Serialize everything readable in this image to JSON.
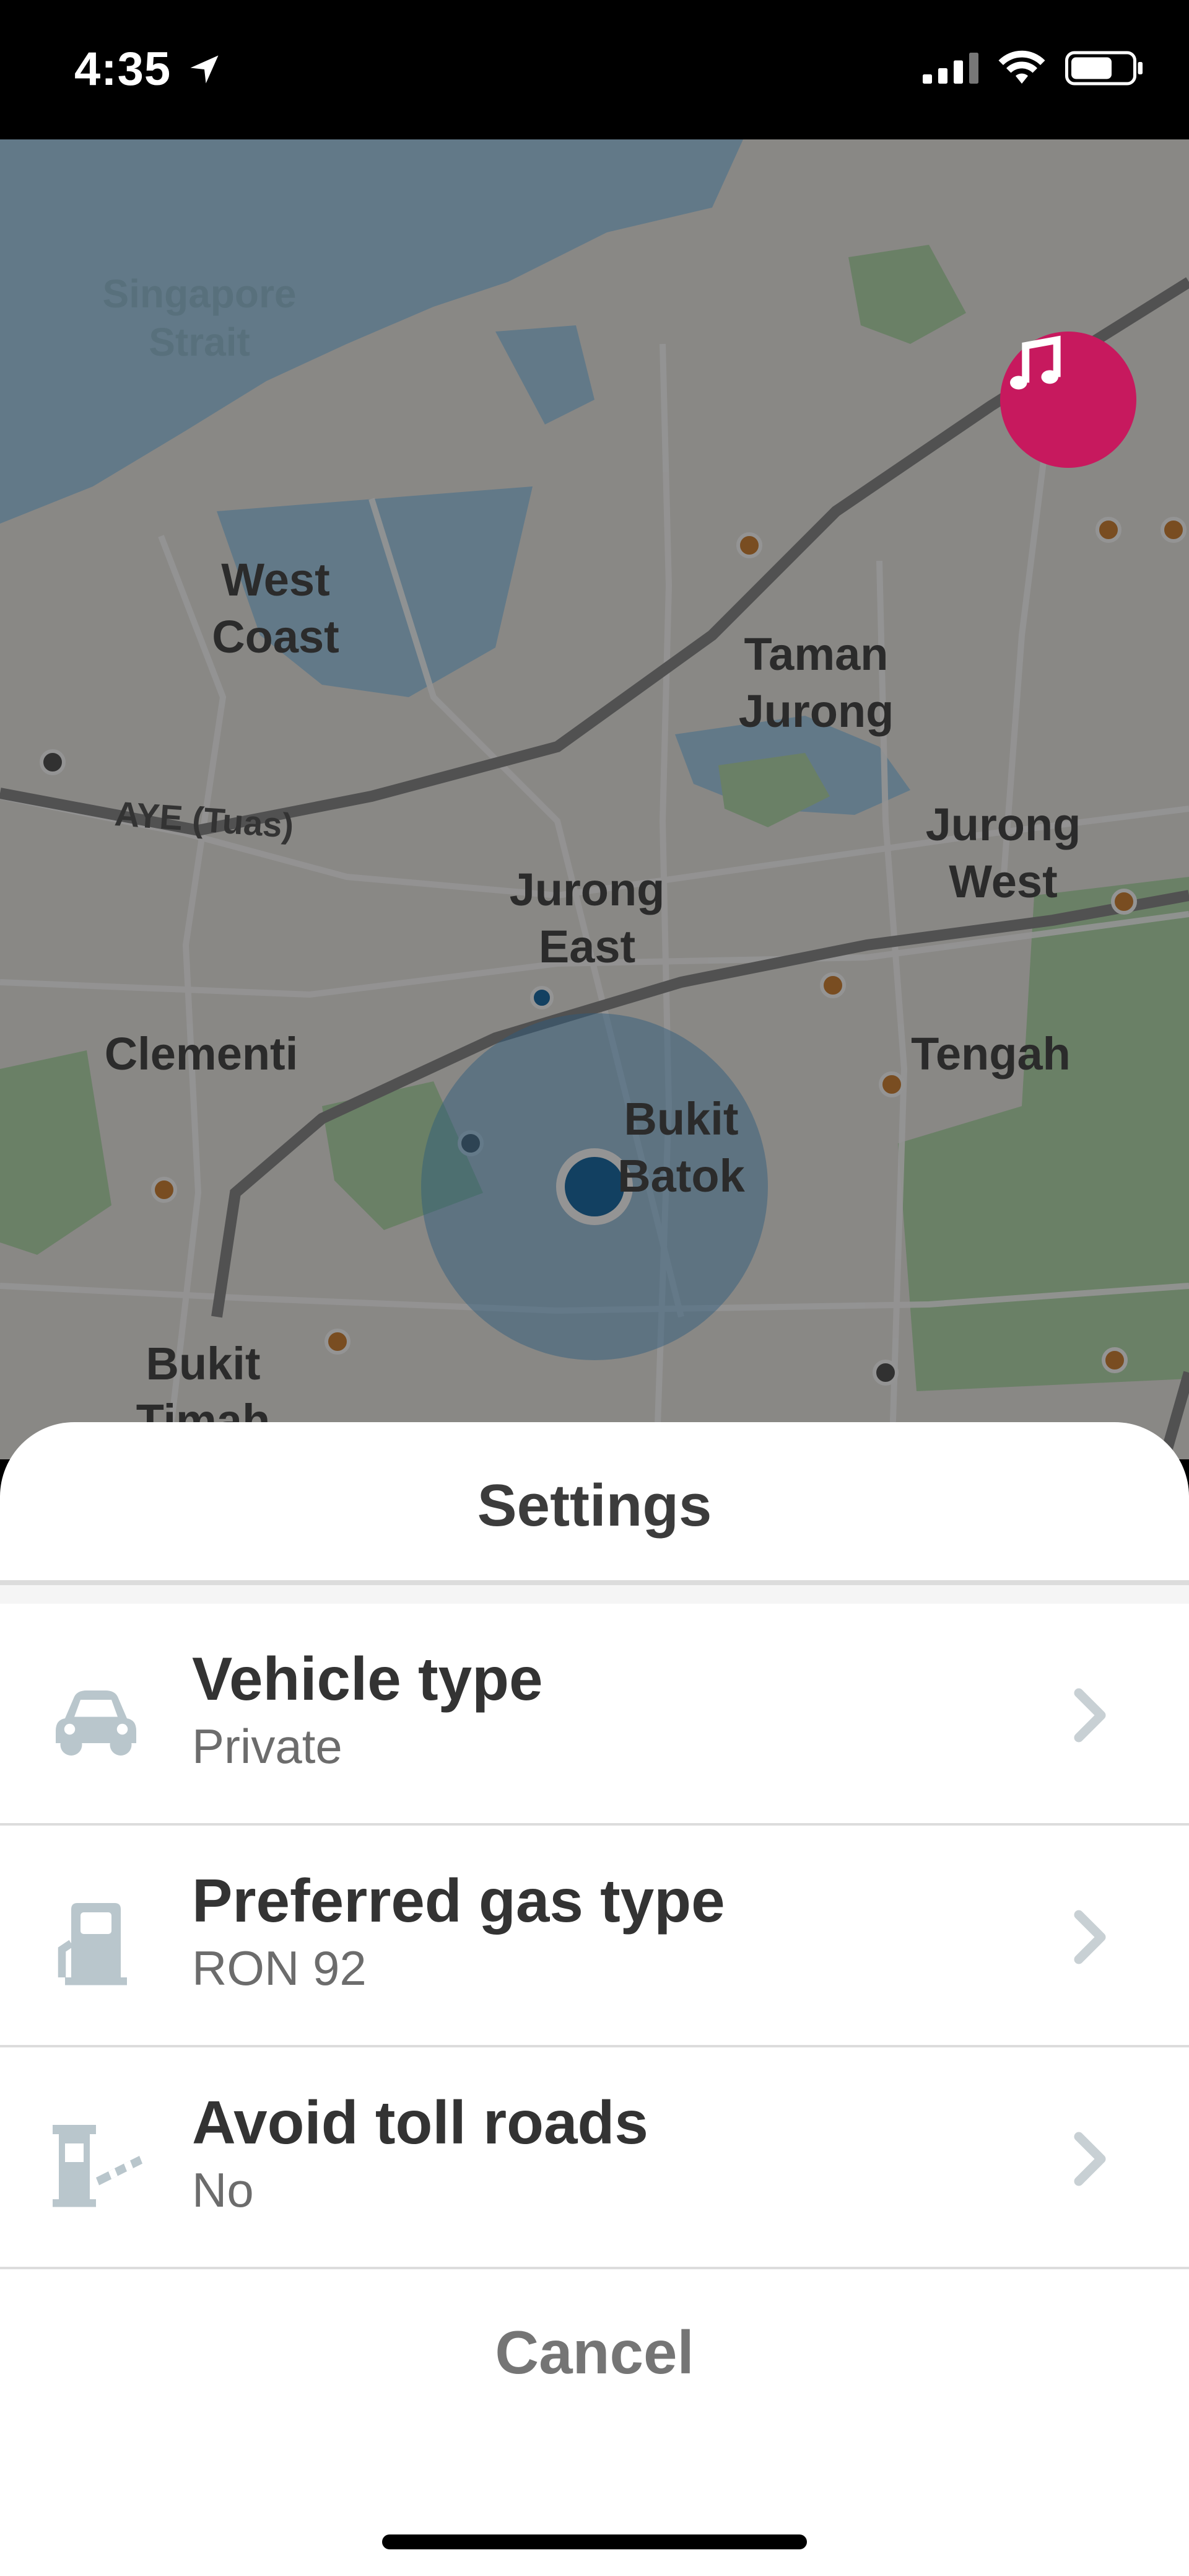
{
  "status_bar": {
    "time": "4:35"
  },
  "map": {
    "labels": {
      "water": "Singapore\nStrait",
      "west_coast": "West\nCoast",
      "taman_jurong": "Taman\nJurong",
      "jurong_west": "Jurong\nWest",
      "jurong_east": "Jurong\nEast",
      "clementi": "Clementi",
      "tengah": "Tengah",
      "bukit_batok": "Bukit\nBatok",
      "bukit_timah": "Bukit\nTimah",
      "road": "AYE (Tuas)"
    },
    "colors": {
      "water": "#a9d1ea",
      "land": "#eceae6",
      "park": "#b7dcb0",
      "current_location": "#1f6fa8"
    }
  },
  "sheet": {
    "title": "Settings",
    "rows": [
      {
        "title": "Vehicle type",
        "value": "Private",
        "icon": "car-icon"
      },
      {
        "title": "Preferred gas type",
        "value": "RON 92",
        "icon": "gas-pump-icon"
      },
      {
        "title": "Avoid toll roads",
        "value": "No",
        "icon": "toll-booth-icon"
      }
    ],
    "cancel_label": "Cancel"
  }
}
